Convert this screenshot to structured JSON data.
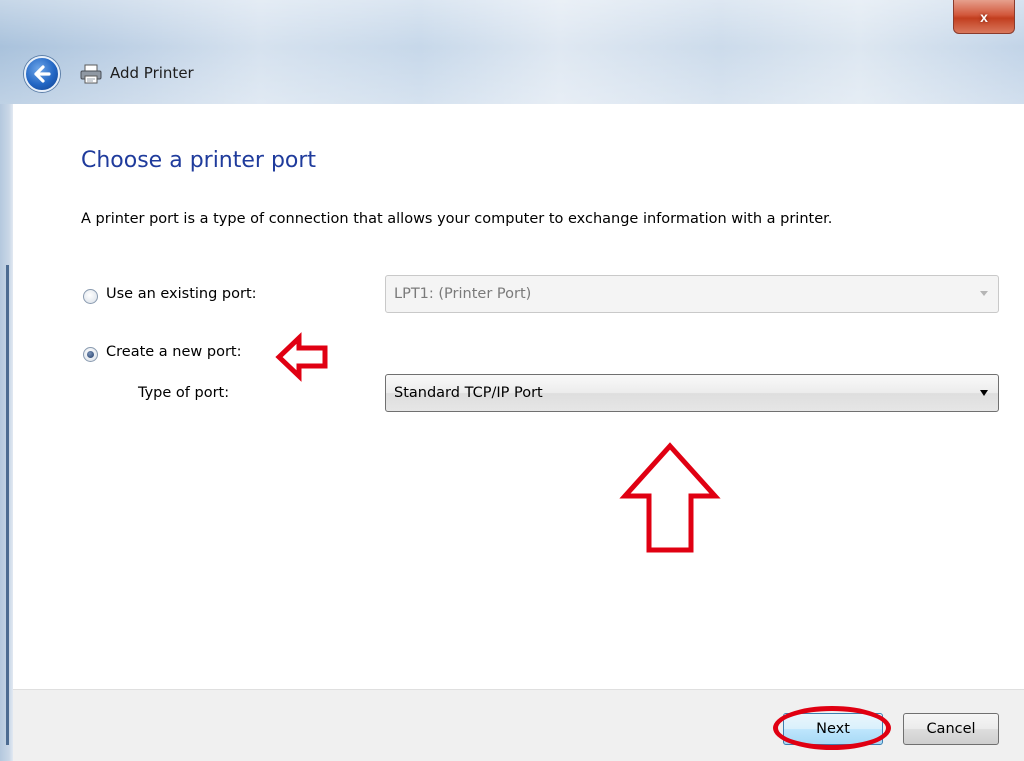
{
  "window": {
    "title": "Add Printer",
    "close_label": "x"
  },
  "page": {
    "title": "Choose a printer port",
    "description": "A printer port is a type of connection that allows your computer to exchange information with a printer."
  },
  "options": {
    "existing_label": "Use an existing port:",
    "existing_selected": false,
    "existing_value": "LPT1: (Printer Port)",
    "new_label": "Create a new port:",
    "new_selected": true,
    "type_label": "Type of port:",
    "type_value": "Standard TCP/IP Port"
  },
  "footer": {
    "next_label": "Next",
    "cancel_label": "Cancel"
  },
  "colors": {
    "title_blue": "#1f3b9c",
    "annotation_red": "#e00012"
  },
  "icons": [
    "back-arrow-icon",
    "printer-icon",
    "close-icon",
    "dropdown-caret-icon"
  ]
}
